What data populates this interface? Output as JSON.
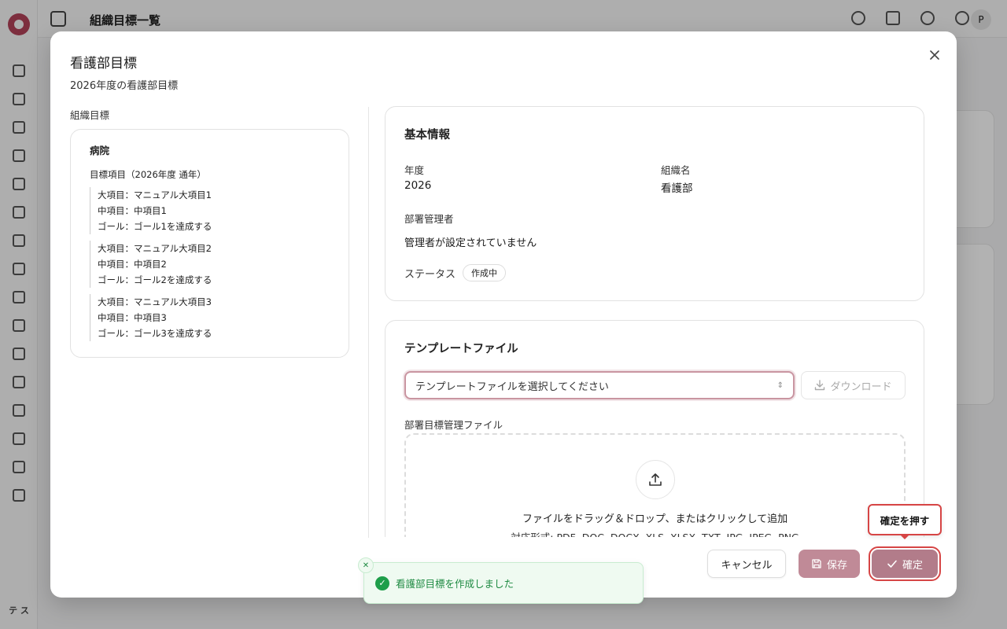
{
  "app": {
    "header_title": "組織目標一覧",
    "user_initial": "P",
    "sidebar_user": "テ ス"
  },
  "modal": {
    "title": "看護部目標",
    "description": "2026年度の看護部目標",
    "org_goals": {
      "section_label": "組織目標",
      "org_name": "病院",
      "period": "目標項目（2026年度 通年）",
      "groups": [
        {
          "major": "大項目：マニュアル大項目1",
          "middle": "中項目：中項目1",
          "goal": "ゴール：ゴール1を達成する"
        },
        {
          "major": "大項目：マニュアル大項目2",
          "middle": "中項目：中項目2",
          "goal": "ゴール：ゴール2を達成する"
        },
        {
          "major": "大項目：マニュアル大項目3",
          "middle": "中項目：中項目3",
          "goal": "ゴール：ゴール3を達成する"
        }
      ]
    },
    "basic_info": {
      "heading": "基本情報",
      "year_label": "年度",
      "year_value": "2026",
      "org_label": "組織名",
      "org_value": "看護部",
      "manager_label": "部署管理者",
      "manager_value": "管理者が設定されていません",
      "status_label": "ステータス",
      "status_value": "作成中"
    },
    "template": {
      "heading": "テンプレートファイル",
      "select_placeholder": "テンプレートファイルを選択してください",
      "download_label": "ダウンロード",
      "file_label": "部署目標管理ファイル",
      "drop_text": "ファイルをドラッグ＆ドロップ、またはクリックして追加",
      "formats": "対応形式: PDF, DOC, DOCX, XLS, XLSX, TXT, JPG, JPEG, PNG"
    },
    "footer": {
      "cancel_label": "キャンセル",
      "save_label": "保存",
      "confirm_label": "確定"
    }
  },
  "tooltip": {
    "text": "確定を押す"
  },
  "toast": {
    "message": "看護部目標を作成しました"
  },
  "colors": {
    "brand": "#b3435a",
    "primary_button": "#b27c8a",
    "highlight": "#d64545",
    "success": "#1e9e4a"
  }
}
